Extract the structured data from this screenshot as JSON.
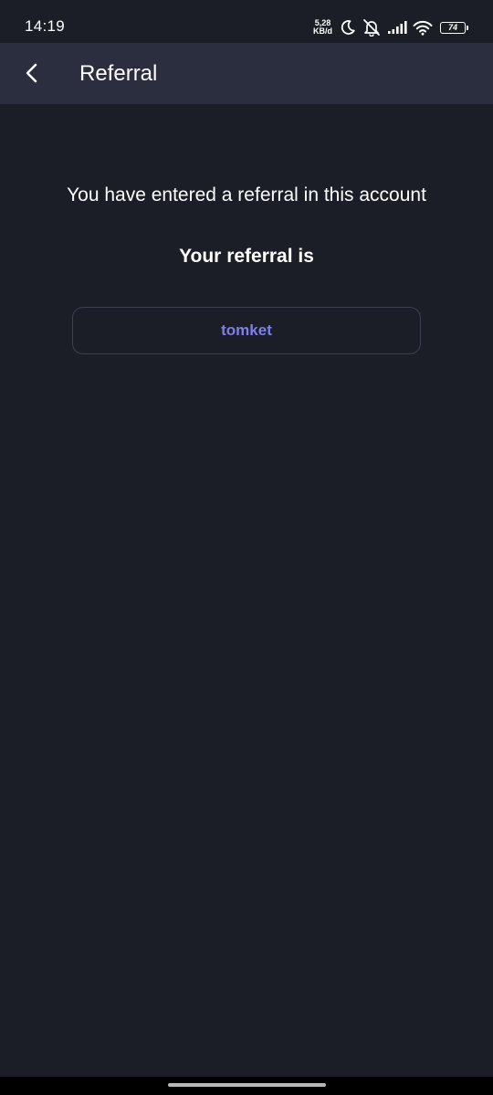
{
  "status_bar": {
    "time": "14:19",
    "net_speed_value": "5,28",
    "net_speed_unit": "KB/d",
    "battery_level": "74",
    "icons": [
      "moon-icon",
      "mute-icon",
      "signal-icon",
      "wifi-icon",
      "battery-icon"
    ]
  },
  "header": {
    "title": "Referral",
    "back_icon": "chevron-left-icon"
  },
  "main": {
    "message": "You have entered a referral in this account",
    "subtitle": "Your referral is",
    "referral_code": "tomket"
  },
  "colors": {
    "background": "#1b1e26",
    "app_bar": "#2a2e3f",
    "accent": "#7f7fea",
    "box_border": "#3c4050"
  }
}
